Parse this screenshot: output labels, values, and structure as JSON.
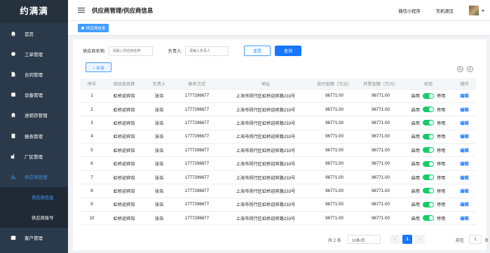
{
  "app": {
    "brand": "约满满"
  },
  "sidebar": {
    "items": [
      {
        "label": "首页",
        "icon": "home-icon"
      },
      {
        "label": "工单管理",
        "icon": "ticket-icon"
      },
      {
        "label": "合同管理",
        "icon": "contract-icon"
      },
      {
        "label": "设备管理",
        "icon": "device-icon"
      },
      {
        "label": "进销存管理",
        "icon": "home-icon"
      },
      {
        "label": "报表管理",
        "icon": "report-icon"
      },
      {
        "label": "厂区管理",
        "icon": "factory-icon"
      },
      {
        "label": "供应商管理",
        "icon": "chart-icon"
      }
    ],
    "subitems": [
      {
        "label": "供应商信息"
      },
      {
        "label": "供应商账号"
      }
    ],
    "bottom_item": {
      "label": "客户管理",
      "icon": "customer-icon"
    }
  },
  "header": {
    "breadcrumb": "供应商管理/供应商信息",
    "link_miniprogram": "微信小程序",
    "user_name": "东机液压"
  },
  "tags": {
    "active_tag": "供应商信息"
  },
  "filter": {
    "name_label": "供应商名称:",
    "name_placeholder": "请输入供应商名称",
    "owner_label": "负责人:",
    "owner_placeholder": "请输入负责人",
    "reset_label": "重置",
    "search_label": "查询"
  },
  "toolbar": {
    "add_label": "+ 新增"
  },
  "table": {
    "headers": [
      "序号",
      "供应商名称",
      "负责人",
      "联系方式",
      "地址",
      "应付金额（万元）",
      "开票金额（万元）",
      "状态",
      "操作"
    ],
    "rows": [
      {
        "no": "1",
        "name": "虹桥迎宾馆",
        "owner": "张浩",
        "phone": "1777296677",
        "address": "上海市闵行区虹桥迎宾路233号",
        "payable": "96771.00",
        "invoiced": "96771.00",
        "on": "启用",
        "off": "停用",
        "action": "编辑"
      },
      {
        "no": "2",
        "name": "虹桥迎宾馆",
        "owner": "张浩",
        "phone": "1777296677",
        "address": "上海市闵行区虹桥迎宾路233号",
        "payable": "96771.00",
        "invoiced": "96771.00",
        "on": "启用",
        "off": "停用",
        "action": "编辑"
      },
      {
        "no": "3",
        "name": "虹桥迎宾馆",
        "owner": "张浩",
        "phone": "1777296677",
        "address": "上海市闵行区虹桥迎宾路233号",
        "payable": "96771.00",
        "invoiced": "96771.00",
        "on": "启用",
        "off": "停用",
        "action": "编辑"
      },
      {
        "no": "4",
        "name": "虹桥迎宾馆",
        "owner": "张浩",
        "phone": "1777296677",
        "address": "上海市闵行区虹桥迎宾路233号",
        "payable": "96771.00",
        "invoiced": "96771.00",
        "on": "启用",
        "off": "停用",
        "action": "编辑"
      },
      {
        "no": "5",
        "name": "虹桥迎宾馆",
        "owner": "张浩",
        "phone": "1777296677",
        "address": "上海市闵行区虹桥迎宾路233号",
        "payable": "96771.00",
        "invoiced": "96771.00",
        "on": "启用",
        "off": "停用",
        "action": "编辑"
      },
      {
        "no": "6",
        "name": "虹桥迎宾馆",
        "owner": "张浩",
        "phone": "1777296677",
        "address": "上海市闵行区虹桥迎宾路233号",
        "payable": "96771.00",
        "invoiced": "96771.00",
        "on": "启用",
        "off": "停用",
        "action": "编辑"
      },
      {
        "no": "7",
        "name": "虹桥迎宾馆",
        "owner": "张浩",
        "phone": "1777296677",
        "address": "上海市闵行区虹桥迎宾路233号",
        "payable": "96771.00",
        "invoiced": "96771.00",
        "on": "启用",
        "off": "停用",
        "action": "编辑"
      },
      {
        "no": "8",
        "name": "虹桥迎宾馆",
        "owner": "张浩",
        "phone": "1777296677",
        "address": "上海市闵行区虹桥迎宾路233号",
        "payable": "96771.00",
        "invoiced": "96771.00",
        "on": "启用",
        "off": "停用",
        "action": "编辑"
      },
      {
        "no": "9",
        "name": "虹桥迎宾馆",
        "owner": "张浩",
        "phone": "1777296677",
        "address": "上海市闵行区虹桥迎宾路233号",
        "payable": "96771.00",
        "invoiced": "96771.00",
        "on": "启用",
        "off": "停用",
        "action": "编辑"
      },
      {
        "no": "10",
        "name": "虹桥迎宾馆",
        "owner": "张浩",
        "phone": "1777296677",
        "address": "上海市闵行区虹桥迎宾路233号",
        "payable": "96771.00",
        "invoiced": "96771.00",
        "on": "启用",
        "off": "停用",
        "action": "编辑"
      }
    ]
  },
  "pagination": {
    "total": "共 2 条",
    "page_size": "10条/页",
    "current_page": "1",
    "goto_label": "前往",
    "goto_value": "1",
    "page_unit": "页"
  },
  "colors": {
    "primary": "#1677ff",
    "sidebar_bg": "#2b3a4a",
    "switch_on": "#13ce66"
  }
}
